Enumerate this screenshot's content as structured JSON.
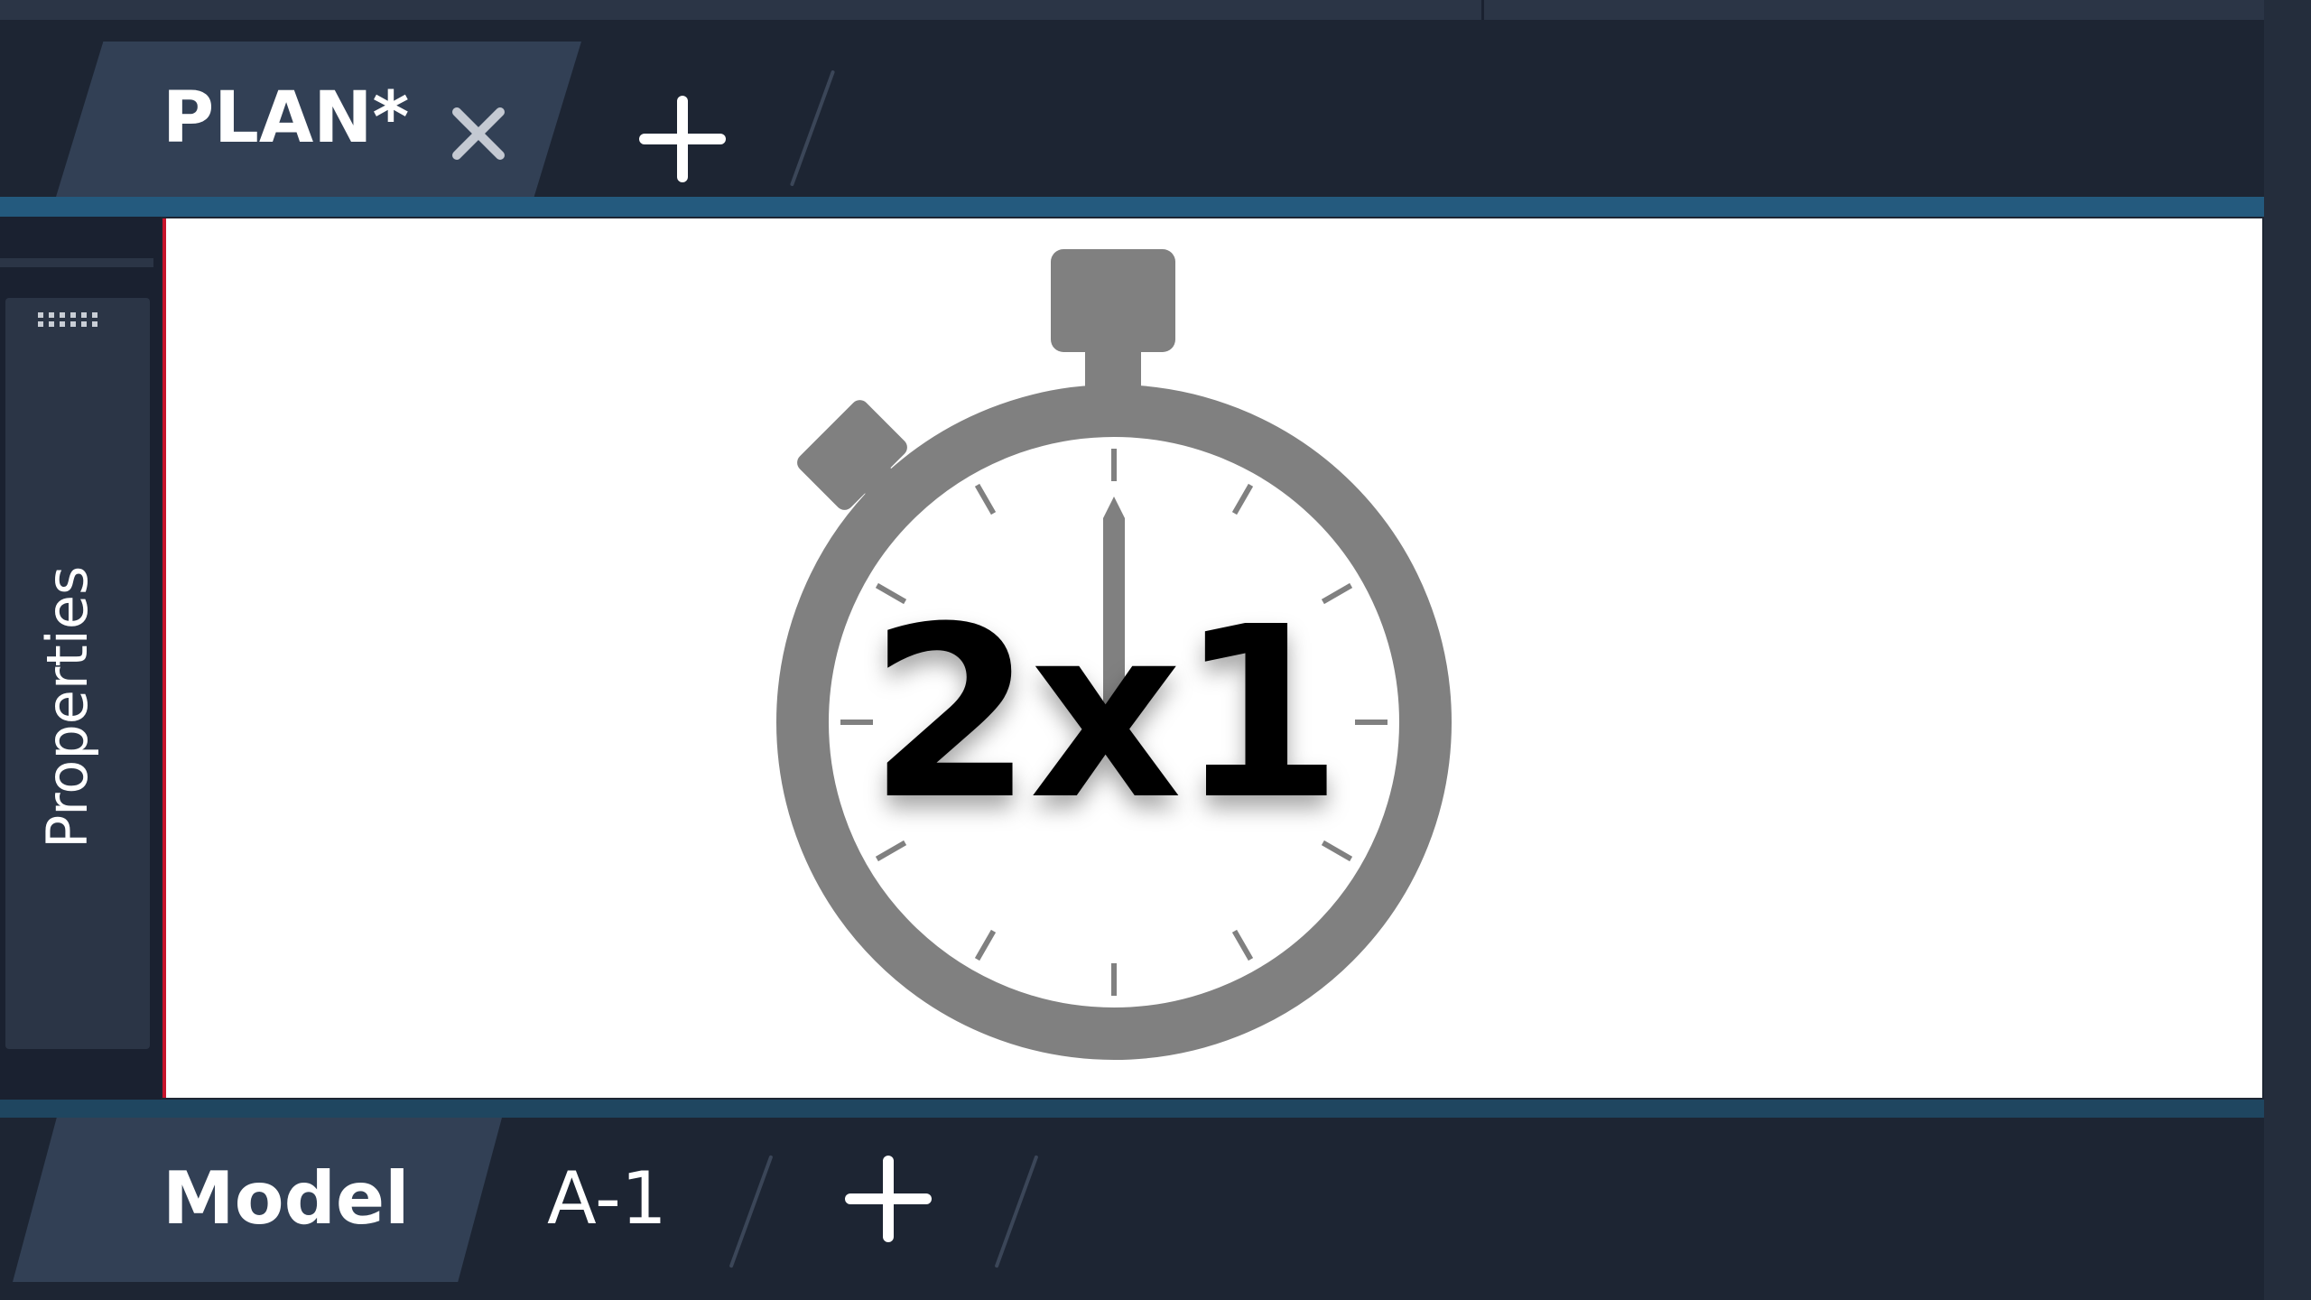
{
  "document_tabs": {
    "active_tab_label": "PLAN*",
    "close_icon": "close-icon",
    "new_tab_icon": "plus-icon"
  },
  "side_panel": {
    "label": "Properties",
    "grip_icon": "grip-dots-icon"
  },
  "canvas": {
    "overlay_text": "2x1",
    "graphic_icon": "stopwatch-icon",
    "stopwatch_color": "#808080",
    "text_color": "#000000"
  },
  "layout_tabs": {
    "tabs": [
      {
        "label": "Model",
        "active": true
      },
      {
        "label": "A-1",
        "active": false
      }
    ],
    "new_layout_icon": "plus-icon"
  },
  "colors": {
    "background": "#1d2533",
    "active_tab": "#324055",
    "viewport_border": "#245a7e",
    "canvas_background": "#ffffff"
  }
}
